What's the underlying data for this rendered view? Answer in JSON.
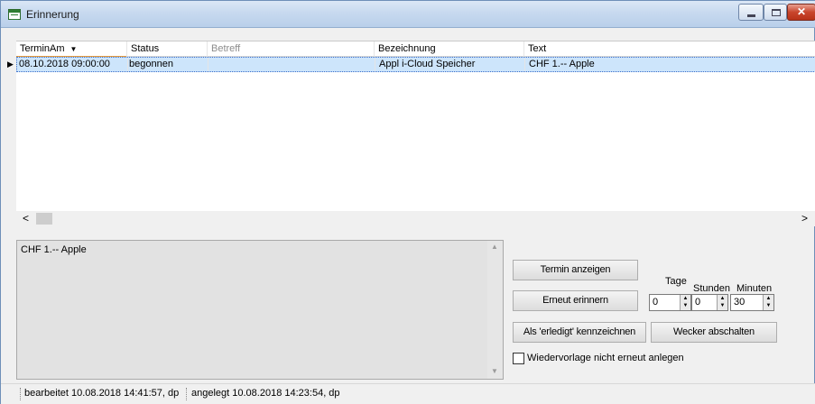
{
  "window": {
    "title": "Erinnerung"
  },
  "grid": {
    "columns": [
      {
        "label": "TerminAm",
        "sorted": "descending"
      },
      {
        "label": "Status"
      },
      {
        "label": "Betreff"
      },
      {
        "label": "Bezeichnung"
      },
      {
        "label": "Text"
      }
    ],
    "sort_arrow": "▼",
    "current_row_marker": "▶",
    "rows": [
      [
        "08.10.2018 09:00:00",
        "begonnen",
        "",
        "Appl i-Cloud Speicher",
        "CHF 1.-- Apple"
      ]
    ]
  },
  "scroll": {
    "left": "<",
    "right": ">",
    "up": "▲",
    "down": "▼"
  },
  "details": {
    "text": "CHF 1.-- Apple"
  },
  "actions": {
    "show_label": "Termin anzeigen",
    "remind_label": "Erneut erinnern",
    "done_label": "Als 'erledigt' kennzeichnen",
    "alarm_label": "Wecker abschalten"
  },
  "snooze": {
    "days_label": "Tage",
    "hours_label": "Stunden",
    "minutes_label": "Minuten",
    "days": "0",
    "hours": "0",
    "minutes": "30"
  },
  "option": {
    "label": "Wiedervorlage nicht erneut anlegen",
    "checked": false
  },
  "status": {
    "edited": "bearbeitet 10.08.2018 14:41:57, dp",
    "created": "angelegt 10.08.2018 14:23:54, dp"
  },
  "colors": {
    "selection": "#cde5fb",
    "sort_indicator": "#e69a3a",
    "close_button": "#c9452c"
  }
}
